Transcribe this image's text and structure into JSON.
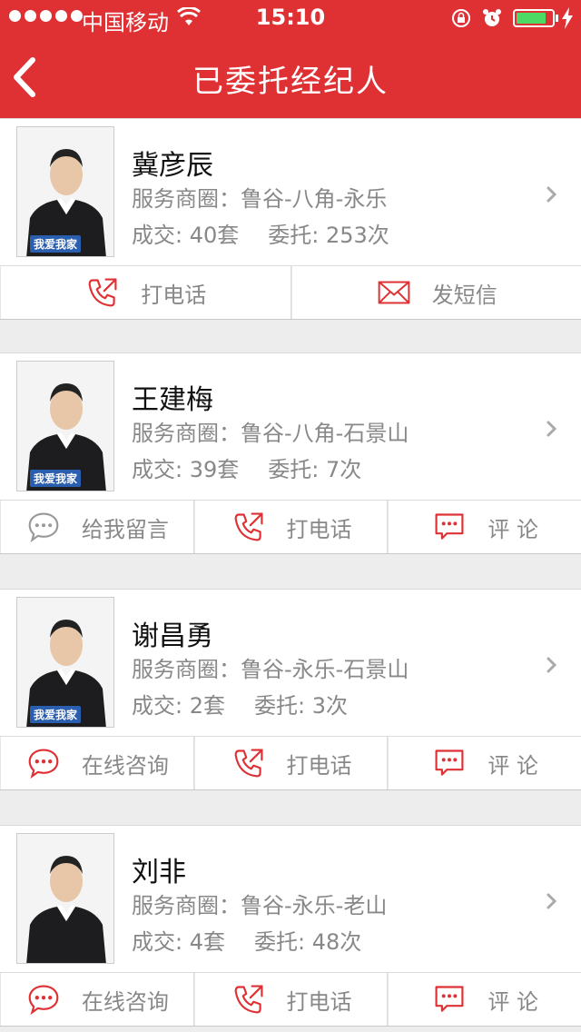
{
  "status_bar": {
    "carrier": "中国移动",
    "time": "15:10",
    "battery_level": 0.85
  },
  "nav": {
    "title": "已委托经纪人"
  },
  "brokers": [
    {
      "name": "冀彦辰",
      "area": "服务商圈：鲁谷-八角-永乐",
      "deals": "成交: 40套",
      "entrusts": "委托: 253次",
      "avatar_badge": "我爱我家",
      "actions": [
        {
          "label": "打电话",
          "icon": "phone-icon"
        },
        {
          "label": "发短信",
          "icon": "envelope-icon"
        }
      ]
    },
    {
      "name": "王建梅",
      "area": "服务商圈：鲁谷-八角-石景山",
      "deals": "成交: 39套",
      "entrusts": "委托: 7次",
      "avatar_badge": "我爱我家",
      "actions": [
        {
          "label": "给我留言",
          "icon": "message-bubble-icon"
        },
        {
          "label": "打电话",
          "icon": "phone-icon"
        },
        {
          "label": "评 论",
          "icon": "comment-icon"
        }
      ]
    },
    {
      "name": "谢昌勇",
      "area": "服务商圈：鲁谷-永乐-石景山",
      "deals": "成交: 2套",
      "entrusts": "委托: 3次",
      "avatar_badge": "我爱我家",
      "actions": [
        {
          "label": "在线咨询",
          "icon": "chat-bubble-icon"
        },
        {
          "label": "打电话",
          "icon": "phone-icon"
        },
        {
          "label": "评 论",
          "icon": "comment-icon"
        }
      ]
    },
    {
      "name": "刘非",
      "area": "服务商圈：鲁谷-永乐-老山",
      "deals": "成交: 4套",
      "entrusts": "委托: 48次",
      "avatar_badge": "",
      "actions": [
        {
          "label": "在线咨询",
          "icon": "chat-bubble-icon"
        },
        {
          "label": "打电话",
          "icon": "phone-icon"
        },
        {
          "label": "评 论",
          "icon": "comment-icon"
        }
      ]
    }
  ],
  "colors": {
    "brand_red": "#df3034",
    "battery_green": "#4cd964",
    "muted_text": "#888888"
  }
}
